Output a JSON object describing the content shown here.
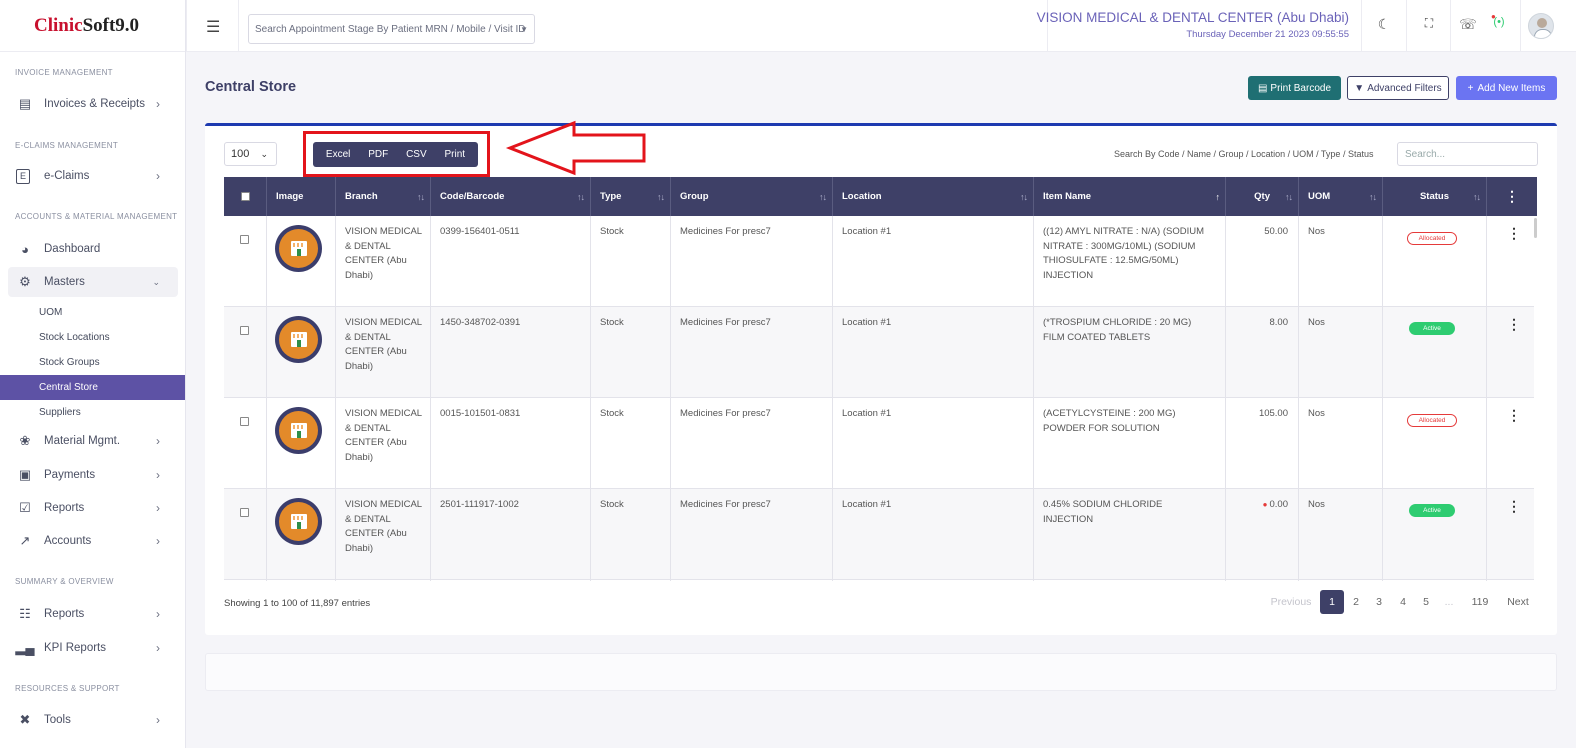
{
  "app": {
    "logo_part1": "Clinic",
    "logo_part2": "Soft",
    "logo_part3": " 9.0"
  },
  "topbar": {
    "search_placeholder": "Search Appointment Stage By Patient MRN / Mobile / Visit ID",
    "clinic_name": "VISION MEDICAL & DENTAL CENTER (Abu Dhabi)",
    "datetime": "Thursday December 21 2023 09:55:55"
  },
  "sidebar": {
    "sections": {
      "invoice": "INVOICE MANAGEMENT",
      "eclaims": "E-CLAIMS MANAGEMENT",
      "accounts_material": "ACCOUNTS & MATERIAL MANAGEMENT",
      "summary": "SUMMARY & OVERVIEW",
      "resources": "RESOURCES & SUPPORT"
    },
    "items": {
      "invoices": "Invoices & Receipts",
      "eclaims": "e-Claims",
      "dashboard": "Dashboard",
      "masters": "Masters",
      "material": "Material Mgmt.",
      "payments": "Payments",
      "reports": "Reports",
      "accounts": "Accounts",
      "summary_reports": "Reports",
      "kpi": "KPI Reports",
      "tools": "Tools"
    },
    "masters_sub": {
      "uom": "UOM",
      "stock_locations": "Stock Locations",
      "stock_groups": "Stock Groups",
      "central_store": "Central Store",
      "suppliers": "Suppliers"
    }
  },
  "page": {
    "title": "Central Store",
    "buttons": {
      "print_barcode": "Print Barcode",
      "advanced_filters": "Advanced Filters",
      "add_new": "Add New Items"
    },
    "page_size": "100",
    "export": {
      "excel": "Excel",
      "pdf": "PDF",
      "csv": "CSV",
      "print": "Print"
    },
    "search_label": "Search By Code / Name / Group / Location / UOM / Type / Status",
    "search_placeholder": "Search..."
  },
  "table": {
    "headers": {
      "image": "Image",
      "branch": "Branch",
      "code": "Code/Barcode",
      "type": "Type",
      "group": "Group",
      "location": "Location",
      "item": "Item Name",
      "qty": "Qty",
      "uom": "UOM",
      "status": "Status"
    },
    "rows": [
      {
        "branch": "VISION MEDICAL & DENTAL CENTER (Abu Dhabi)",
        "code": "0399-156401-0511",
        "type": "Stock",
        "group": "Medicines For presc7",
        "location": "Location #1",
        "item": "((12) AMYL NITRATE : N/A) (SODIUM NITRATE : 300MG/10ML) (SODIUM THIOSULFATE : 12.5MG/50ML) INJECTION",
        "qty": "50.00",
        "uom": "Nos",
        "status": "Allocated"
      },
      {
        "branch": "VISION MEDICAL & DENTAL CENTER (Abu Dhabi)",
        "code": "1450-348702-0391",
        "type": "Stock",
        "group": "Medicines For presc7",
        "location": "Location #1",
        "item": "(*TROSPIUM CHLORIDE : 20 MG) FILM COATED TABLETS",
        "qty": "8.00",
        "uom": "Nos",
        "status": "Active"
      },
      {
        "branch": "VISION MEDICAL & DENTAL CENTER (Abu Dhabi)",
        "code": "0015-101501-0831",
        "type": "Stock",
        "group": "Medicines For presc7",
        "location": "Location #1",
        "item": "(ACETYLCYSTEINE : 200 MG) POWDER FOR SOLUTION",
        "qty": "105.00",
        "uom": "Nos",
        "status": "Allocated"
      },
      {
        "branch": "VISION MEDICAL & DENTAL CENTER (Abu Dhabi)",
        "code": "2501-111917-1002",
        "type": "Stock",
        "group": "Medicines For presc7",
        "location": "Location #1",
        "item": "0.45% SODIUM CHLORIDE INJECTION",
        "qty": "0.00",
        "uom": "Nos",
        "status": "Active"
      }
    ]
  },
  "footer": {
    "showing": "Showing 1 to 100 of 11,897 entries",
    "pagination": {
      "previous": "Previous",
      "p1": "1",
      "p2": "2",
      "p3": "3",
      "p4": "4",
      "p5": "5",
      "ellipsis": "...",
      "last": "119",
      "next": "Next"
    }
  },
  "colors": {
    "primary": "#3e4067",
    "accent": "#5d52a5",
    "teal": "#1f6f73",
    "add": "#6b74f2",
    "highlight": "#e3141b"
  }
}
